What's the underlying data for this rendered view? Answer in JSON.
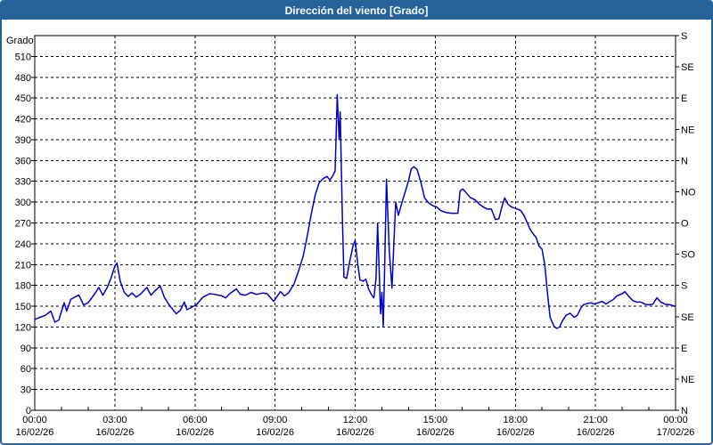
{
  "window": {
    "title": "Dirección del viento [Grado]"
  },
  "colors": {
    "titlebar_bg": "#26639b",
    "titlebar_text": "#ffffff",
    "frame_border": "#26639b",
    "line": "#0000cc",
    "axis": "#000000",
    "grid": "#000000",
    "plot_bg": "#ffffff"
  },
  "chart_data": {
    "type": "line",
    "title": "Dirección del viento [Grado]",
    "ylabel": "Grado",
    "grid": "dashed",
    "y_axis": {
      "min": 0,
      "max": 540,
      "tick_step": 30,
      "label_max": 510,
      "title": "Grado"
    },
    "right_axis": {
      "tick_step": 45,
      "labels_bottom_to_top": [
        "N",
        "NE",
        "E",
        "SE",
        "S",
        "SO",
        "O",
        "NO",
        "N",
        "NE",
        "E",
        "SE",
        "S"
      ]
    },
    "x_axis": {
      "min_hours": 0,
      "max_hours": 24,
      "major_step_hours": 3,
      "minor_step_hours": 1,
      "major_labels": [
        {
          "time": "00:00",
          "date": "16/02/26"
        },
        {
          "time": "03:00",
          "date": "16/02/26"
        },
        {
          "time": "06:00",
          "date": "16/02/26"
        },
        {
          "time": "09:00",
          "date": "16/02/26"
        },
        {
          "time": "12:00",
          "date": "16/02/26"
        },
        {
          "time": "15:00",
          "date": "16/02/26"
        },
        {
          "time": "18:00",
          "date": "16/02/26"
        },
        {
          "time": "21:00",
          "date": "16/02/26"
        },
        {
          "time": "00:00",
          "date": "17/02/26"
        }
      ]
    },
    "series": [
      {
        "name": "Dirección del viento",
        "color": "#0000cc",
        "points": [
          [
            0,
            131
          ],
          [
            0.2,
            134
          ],
          [
            0.4,
            137
          ],
          [
            0.6,
            143
          ],
          [
            0.75,
            127
          ],
          [
            0.9,
            130
          ],
          [
            1.1,
            155
          ],
          [
            1.2,
            143
          ],
          [
            1.35,
            160
          ],
          [
            1.5,
            163
          ],
          [
            1.65,
            166
          ],
          [
            1.83,
            152
          ],
          [
            2.0,
            155
          ],
          [
            2.25,
            168
          ],
          [
            2.4,
            177
          ],
          [
            2.55,
            166
          ],
          [
            2.7,
            176
          ],
          [
            2.85,
            190
          ],
          [
            3.0,
            208
          ],
          [
            3.08,
            212
          ],
          [
            3.2,
            186
          ],
          [
            3.35,
            170
          ],
          [
            3.5,
            164
          ],
          [
            3.65,
            169
          ],
          [
            3.8,
            163
          ],
          [
            3.95,
            167
          ],
          [
            4.2,
            177
          ],
          [
            4.35,
            166
          ],
          [
            4.5,
            172
          ],
          [
            4.7,
            179
          ],
          [
            4.85,
            163
          ],
          [
            5.05,
            151
          ],
          [
            5.3,
            139
          ],
          [
            5.45,
            144
          ],
          [
            5.6,
            156
          ],
          [
            5.7,
            145
          ],
          [
            5.85,
            148
          ],
          [
            6.05,
            152
          ],
          [
            6.3,
            163
          ],
          [
            6.55,
            168
          ],
          [
            6.75,
            167
          ],
          [
            7.0,
            165
          ],
          [
            7.15,
            162
          ],
          [
            7.3,
            168
          ],
          [
            7.55,
            175
          ],
          [
            7.7,
            167
          ],
          [
            7.9,
            166
          ],
          [
            8.1,
            170
          ],
          [
            8.3,
            167
          ],
          [
            8.55,
            169
          ],
          [
            8.7,
            168
          ],
          [
            8.95,
            157
          ],
          [
            9.2,
            171
          ],
          [
            9.35,
            165
          ],
          [
            9.5,
            169
          ],
          [
            9.7,
            181
          ],
          [
            9.9,
            203
          ],
          [
            10.05,
            222
          ],
          [
            10.2,
            250
          ],
          [
            10.35,
            282
          ],
          [
            10.5,
            310
          ],
          [
            10.65,
            328
          ],
          [
            10.8,
            334
          ],
          [
            10.95,
            337
          ],
          [
            11.05,
            332
          ],
          [
            11.15,
            337
          ],
          [
            11.25,
            345
          ],
          [
            11.33,
            455
          ],
          [
            11.4,
            390
          ],
          [
            11.44,
            430
          ],
          [
            11.52,
            280
          ],
          [
            11.58,
            192
          ],
          [
            11.68,
            190
          ],
          [
            11.8,
            215
          ],
          [
            11.92,
            237
          ],
          [
            12.0,
            245
          ],
          [
            12.1,
            210
          ],
          [
            12.18,
            188
          ],
          [
            12.3,
            186
          ],
          [
            12.4,
            189
          ],
          [
            12.5,
            175
          ],
          [
            12.62,
            166
          ],
          [
            12.7,
            162
          ],
          [
            12.78,
            190
          ],
          [
            12.84,
            269
          ],
          [
            12.9,
            200
          ],
          [
            12.95,
            139
          ],
          [
            13.0,
            170
          ],
          [
            13.05,
            121
          ],
          [
            13.1,
            200
          ],
          [
            13.17,
            333
          ],
          [
            13.28,
            230
          ],
          [
            13.38,
            176
          ],
          [
            13.45,
            240
          ],
          [
            13.52,
            300
          ],
          [
            13.62,
            281
          ],
          [
            13.75,
            299
          ],
          [
            13.9,
            318
          ],
          [
            14.0,
            331
          ],
          [
            14.1,
            348
          ],
          [
            14.2,
            351
          ],
          [
            14.32,
            347
          ],
          [
            14.45,
            330
          ],
          [
            14.6,
            306
          ],
          [
            14.75,
            299
          ],
          [
            14.9,
            295
          ],
          [
            15.05,
            293
          ],
          [
            15.2,
            288
          ],
          [
            15.4,
            285
          ],
          [
            15.6,
            284
          ],
          [
            15.85,
            284
          ],
          [
            15.93,
            316
          ],
          [
            16.03,
            319
          ],
          [
            16.15,
            314
          ],
          [
            16.3,
            307
          ],
          [
            16.5,
            303
          ],
          [
            16.65,
            297
          ],
          [
            16.8,
            293
          ],
          [
            16.95,
            290
          ],
          [
            17.1,
            290
          ],
          [
            17.25,
            275
          ],
          [
            17.38,
            276
          ],
          [
            17.5,
            294
          ],
          [
            17.6,
            306
          ],
          [
            17.72,
            297
          ],
          [
            17.85,
            293
          ],
          [
            18.0,
            291
          ],
          [
            18.2,
            288
          ],
          [
            18.32,
            281
          ],
          [
            18.45,
            270
          ],
          [
            18.55,
            261
          ],
          [
            18.65,
            255
          ],
          [
            18.78,
            249
          ],
          [
            18.88,
            237
          ],
          [
            19.0,
            232
          ],
          [
            19.1,
            210
          ],
          [
            19.2,
            170
          ],
          [
            19.3,
            134
          ],
          [
            19.45,
            121
          ],
          [
            19.55,
            118
          ],
          [
            19.65,
            120
          ],
          [
            19.78,
            130
          ],
          [
            19.9,
            137
          ],
          [
            20.05,
            140
          ],
          [
            20.2,
            134
          ],
          [
            20.32,
            137
          ],
          [
            20.45,
            147
          ],
          [
            20.55,
            152
          ],
          [
            20.7,
            154
          ],
          [
            20.85,
            155
          ],
          [
            20.95,
            153
          ],
          [
            21.1,
            155
          ],
          [
            21.25,
            157
          ],
          [
            21.4,
            153
          ],
          [
            21.5,
            156
          ],
          [
            21.65,
            159
          ],
          [
            21.8,
            165
          ],
          [
            22.0,
            168
          ],
          [
            22.1,
            171
          ],
          [
            22.25,
            164
          ],
          [
            22.4,
            158
          ],
          [
            22.55,
            156
          ],
          [
            22.7,
            156
          ],
          [
            22.85,
            153
          ],
          [
            23.0,
            152
          ],
          [
            23.15,
            153
          ],
          [
            23.3,
            162
          ],
          [
            23.45,
            156
          ],
          [
            23.6,
            153
          ],
          [
            23.8,
            152
          ],
          [
            23.97,
            150
          ]
        ]
      }
    ]
  }
}
